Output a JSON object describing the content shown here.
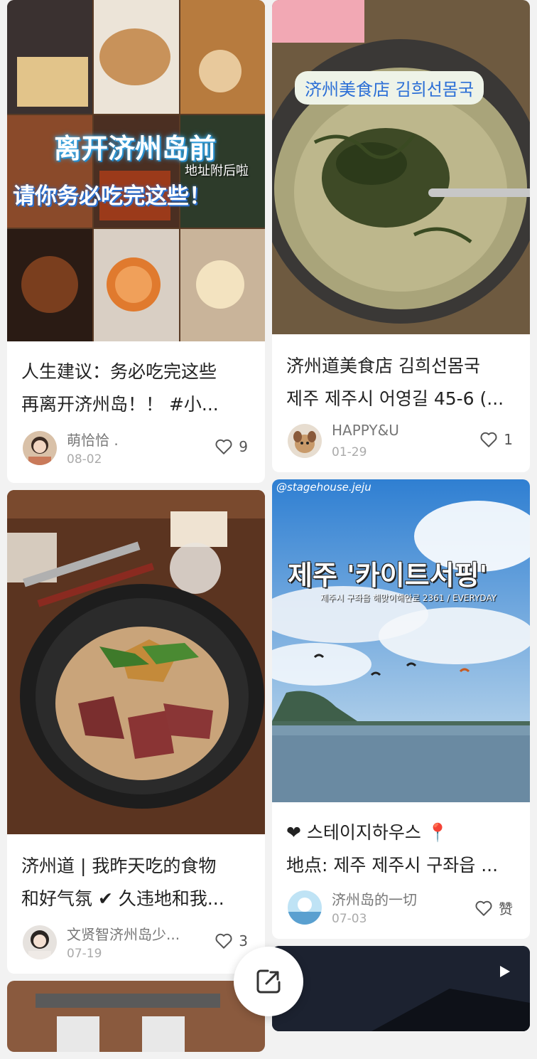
{
  "posts": [
    {
      "title_line1": "人生建议：务必吃完这些",
      "title_line2": "再离开济州岛！！ #小...",
      "overlay_title": "离开济州岛前",
      "overlay_sub": "地址附后啦",
      "overlay_main": "请你务必吃完这些！",
      "author": "萌恰恰 .",
      "date": "08-02",
      "likes": "9"
    },
    {
      "title_line1": "济州道美食店 김희선몸국",
      "title_line2": "제주 제주시 어영길 45-6 (...",
      "overlay_banner": "济州美食店 김희선몸국",
      "author": "HAPPY&U",
      "date": "01-29",
      "likes": "1"
    },
    {
      "title_line1": "济州道 | 我昨天吃的食物",
      "title_line2": "和好气氛 ✔ 久违地和我...",
      "author": "文贤智济州岛少...",
      "date": "07-19",
      "likes": "3"
    },
    {
      "title_line1": "❤ 스테이지하우스 📍",
      "title_line2": "地点: 제주 제주시 구좌읍 ...",
      "overlay_handle": "@stagehouse.jeju",
      "overlay_main": "제주 '카이트서핑'",
      "overlay_sub": "제주시 구좌읍 해맞이해안로 2361 / EVERYDAY",
      "author": "济州岛的一切",
      "date": "07-03",
      "likes": "赞"
    }
  ],
  "icons": {
    "like": "heart-outline-icon",
    "share": "share-external-icon",
    "video": "play-icon"
  },
  "colors": {
    "background": "#f2f2f2",
    "card": "#ffffff",
    "text": "#222222",
    "muted": "#777777"
  }
}
